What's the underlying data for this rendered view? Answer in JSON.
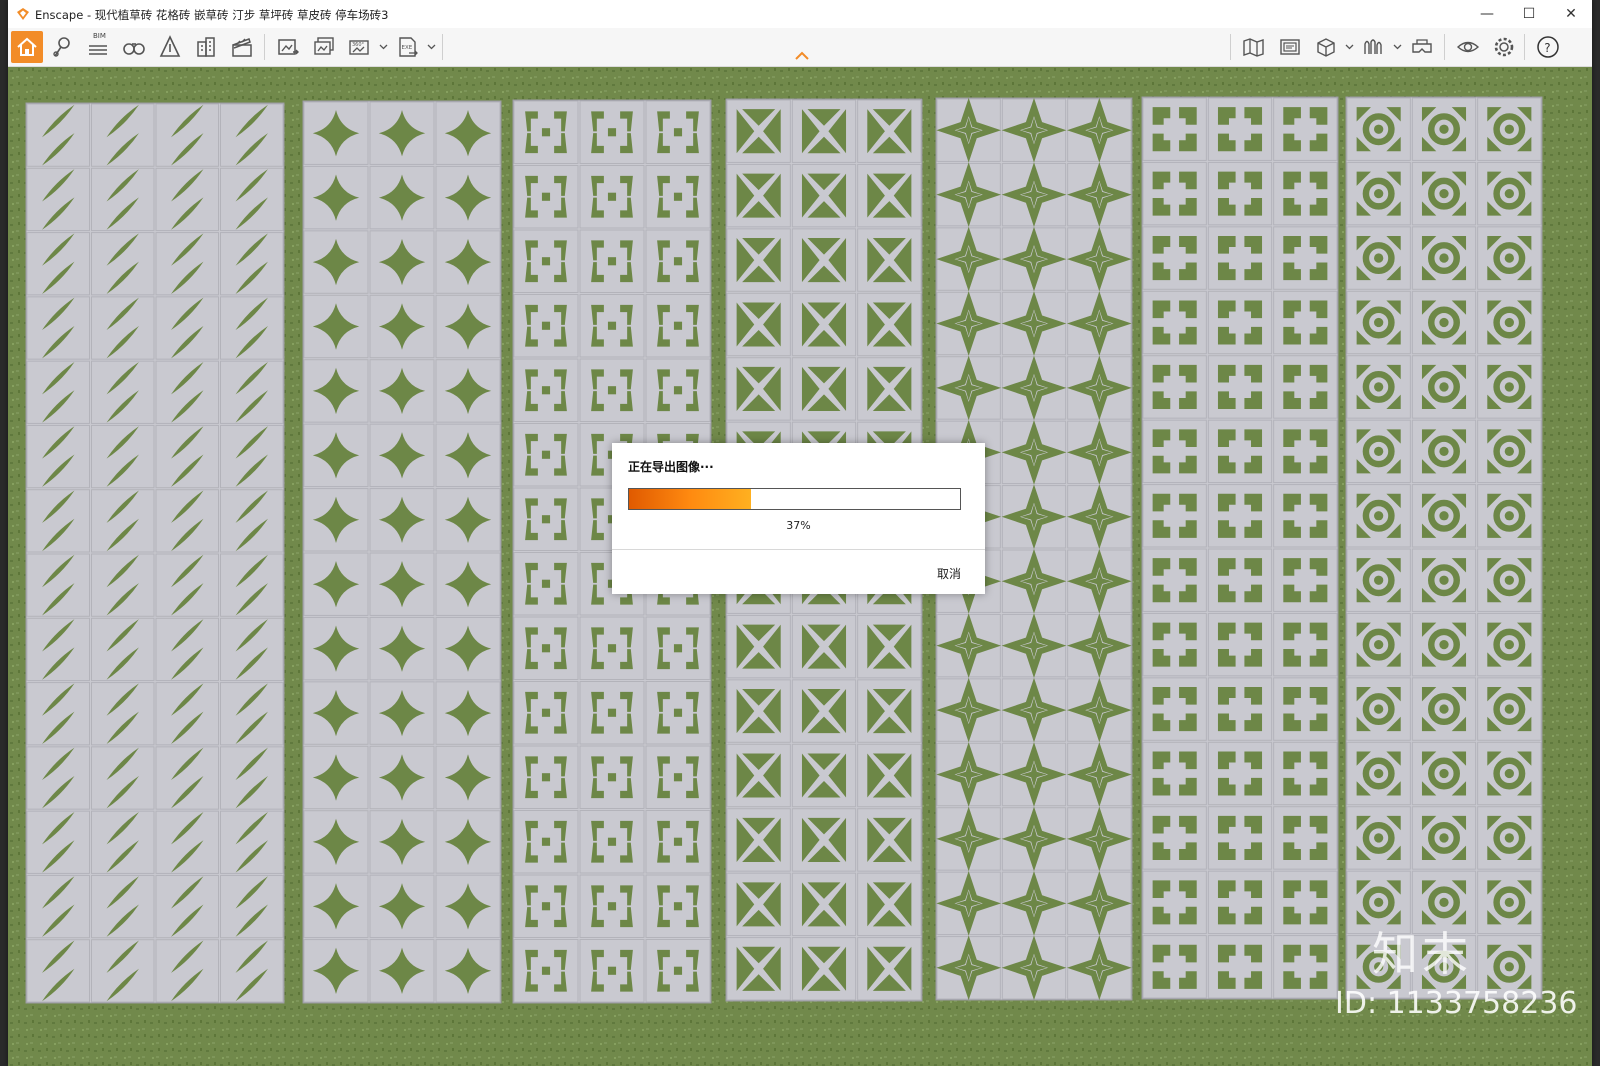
{
  "window": {
    "title": "Enscape - 现代植草砖 花格砖 嵌草砖 汀步 草坪砖 草皮砖 停车场砖3",
    "controls": {
      "minimize": "—",
      "maximize": "☐",
      "close": "✕"
    }
  },
  "toolbar": {
    "bim_label": "BIM",
    "left_tools": [
      "home-icon",
      "location-pin-icon",
      "bim-icon",
      "binoculars-icon",
      "assets-icon",
      "buildings-icon",
      "clapperboard-icon",
      "screenshot-export-icon",
      "batch-render-icon",
      "panorama-360-icon",
      "exe-export-icon"
    ],
    "right_tools": [
      "map-icon",
      "visual-settings-icon",
      "section-box-icon",
      "waveform-icon",
      "vr-headset-icon",
      "eye-icon",
      "gear-icon",
      "help-icon"
    ],
    "accent_color": "#f28c28"
  },
  "dialog": {
    "title": "正在导出图像···",
    "progress_percent": 37,
    "progress_text": "37%",
    "cancel_label": "取消"
  },
  "watermark": {
    "logo": "知末",
    "id_text": "ID: 1133758236"
  },
  "scene": {
    "ground_color": "#6f8a4a",
    "tile_color": "#c9c9d0",
    "patterns": [
      "leaf",
      "star-arc",
      "cross-square",
      "x-cross",
      "four-point-star",
      "corner-notch",
      "ring-square"
    ]
  }
}
